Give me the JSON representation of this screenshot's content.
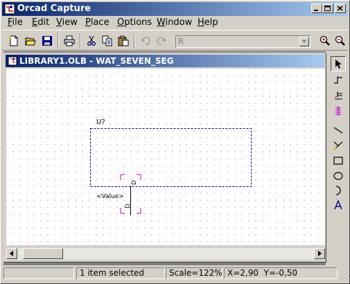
{
  "app": {
    "title": "Orcad Capture",
    "window_controls": {
      "minimize": "minimize-icon",
      "maximize": "maximize-icon",
      "close": "close-icon"
    }
  },
  "menubar": {
    "items": [
      {
        "label": "File",
        "mnemonic": "F"
      },
      {
        "label": "Edit",
        "mnemonic": "E"
      },
      {
        "label": "View",
        "mnemonic": "V"
      },
      {
        "label": "Place",
        "mnemonic": "P"
      },
      {
        "label": "Options",
        "mnemonic": "O"
      },
      {
        "label": "Window",
        "mnemonic": "W"
      },
      {
        "label": "Help",
        "mnemonic": "H"
      }
    ]
  },
  "toolbar": {
    "buttons": [
      "new-icon",
      "open-icon",
      "save-icon",
      "print-icon",
      "cut-icon",
      "copy-icon",
      "paste-icon",
      "undo-icon",
      "redo-icon"
    ],
    "part_combo_value": "R",
    "right_buttons": [
      "zoom-in-icon",
      "zoom-out-icon"
    ]
  },
  "document": {
    "title": "LIBRARY1.OLB - WAT_SEVEN_SEG"
  },
  "canvas": {
    "part_reference": "U?",
    "part_value": "<Value>",
    "pin_number_top": "D",
    "pin_number_bottom": "D"
  },
  "palette": {
    "tools": [
      "select-icon",
      "place-pin-icon",
      "place-pin-array-icon",
      "ieee-symbol-icon",
      "place-line-icon",
      "place-polyline-icon",
      "place-rectangle-icon",
      "place-ellipse-icon",
      "place-arc-icon",
      "place-text-icon"
    ]
  },
  "statusbar": {
    "message": "1 item selected",
    "scale": "Scale=122%",
    "coords": "X=2,90  Y=-0,50"
  },
  "colors": {
    "titlebar_start": "#0a246a",
    "titlebar_end": "#a6caf0",
    "selection": "#00008b",
    "pin_highlight": "#c000c0",
    "chrome": "#d4d0c8"
  }
}
